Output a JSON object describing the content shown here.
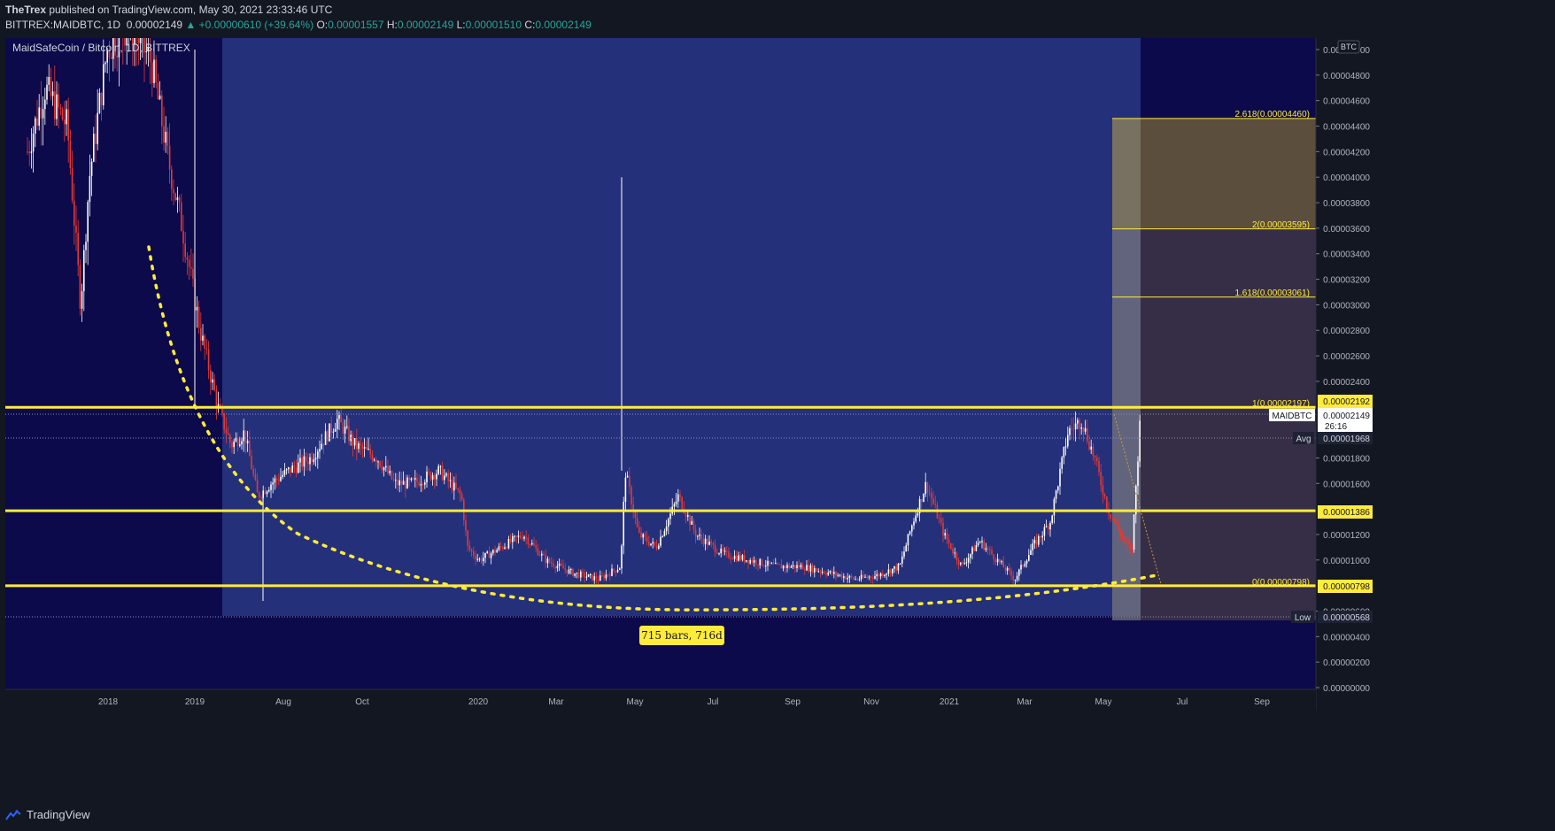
{
  "header": {
    "author": "TheTrex",
    "published_text": "published on TradingView.com, May 30, 2021 23:33:46 UTC",
    "symbol": "BITTREX:MAIDBTC, 1D",
    "last": "0.00002149",
    "change": "▲ +0.00000610 (+39.64%)",
    "o_label": "O:",
    "o": "0.00001557",
    "h_label": "H:",
    "h": "0.00002149",
    "l_label": "L:",
    "l": "0.00001510",
    "c_label": "C:",
    "c": "0.00002149"
  },
  "chart": {
    "legend": "MaidSafeCoin / Bitcoin, 1D, BITTREX",
    "currency_badge": "BTC",
    "price_axis": [
      "0.00005000",
      "0.00004800",
      "0.00004600",
      "0.00004400",
      "0.00004200",
      "0.00004000",
      "0.00003800",
      "0.00003600",
      "0.00003400",
      "0.00003200",
      "0.00003000",
      "0.00002800",
      "0.00002600",
      "0.00002400",
      "0.00001800",
      "0.00001600",
      "0.00001200",
      "0.00001000",
      "0.00000600",
      "0.00000400",
      "0.00000200",
      "0.00000000"
    ],
    "time_axis": [
      "2018",
      "2019",
      "Aug",
      "Oct",
      "2020",
      "Mar",
      "May",
      "Jul",
      "Sep",
      "Nov",
      "2021",
      "Mar",
      "May",
      "Jul",
      "Sep"
    ],
    "fib_levels": [
      {
        "label": "2.618(0.00004460)",
        "value": 4.46e-05
      },
      {
        "label": "2(0.00003595)",
        "value": 3.595e-05
      },
      {
        "label": "1.618(0.00003061)",
        "value": 3.061e-05
      },
      {
        "label": "1(0.00002197)",
        "value": 2.197e-05
      },
      {
        "label": "0(0.00000798)",
        "value": 7.98e-06
      }
    ],
    "horizontal_lines": [
      2.197e-05,
      1.386e-05,
      7.98e-06
    ],
    "price_tags": {
      "resistance": "0.00002192",
      "symbol_name": "MAIDBTC",
      "last_price": "0.00002149",
      "countdown": "26:16",
      "avg_label": "Avg",
      "avg": "0.00001968",
      "support_mid": "0.00001386",
      "support_low": "0.00000798",
      "low_label": "Low",
      "low": "0.00000568"
    },
    "range_label": "715 bars, 716d",
    "colors": {
      "background": "#0c0a4a",
      "range_box": "#25307a",
      "level_line": "#ffeb3b",
      "candle_up": "#ffffff",
      "candle_down": "#e53935",
      "axis_bg": "#131722"
    }
  },
  "footer": {
    "brand": "TradingView"
  }
}
